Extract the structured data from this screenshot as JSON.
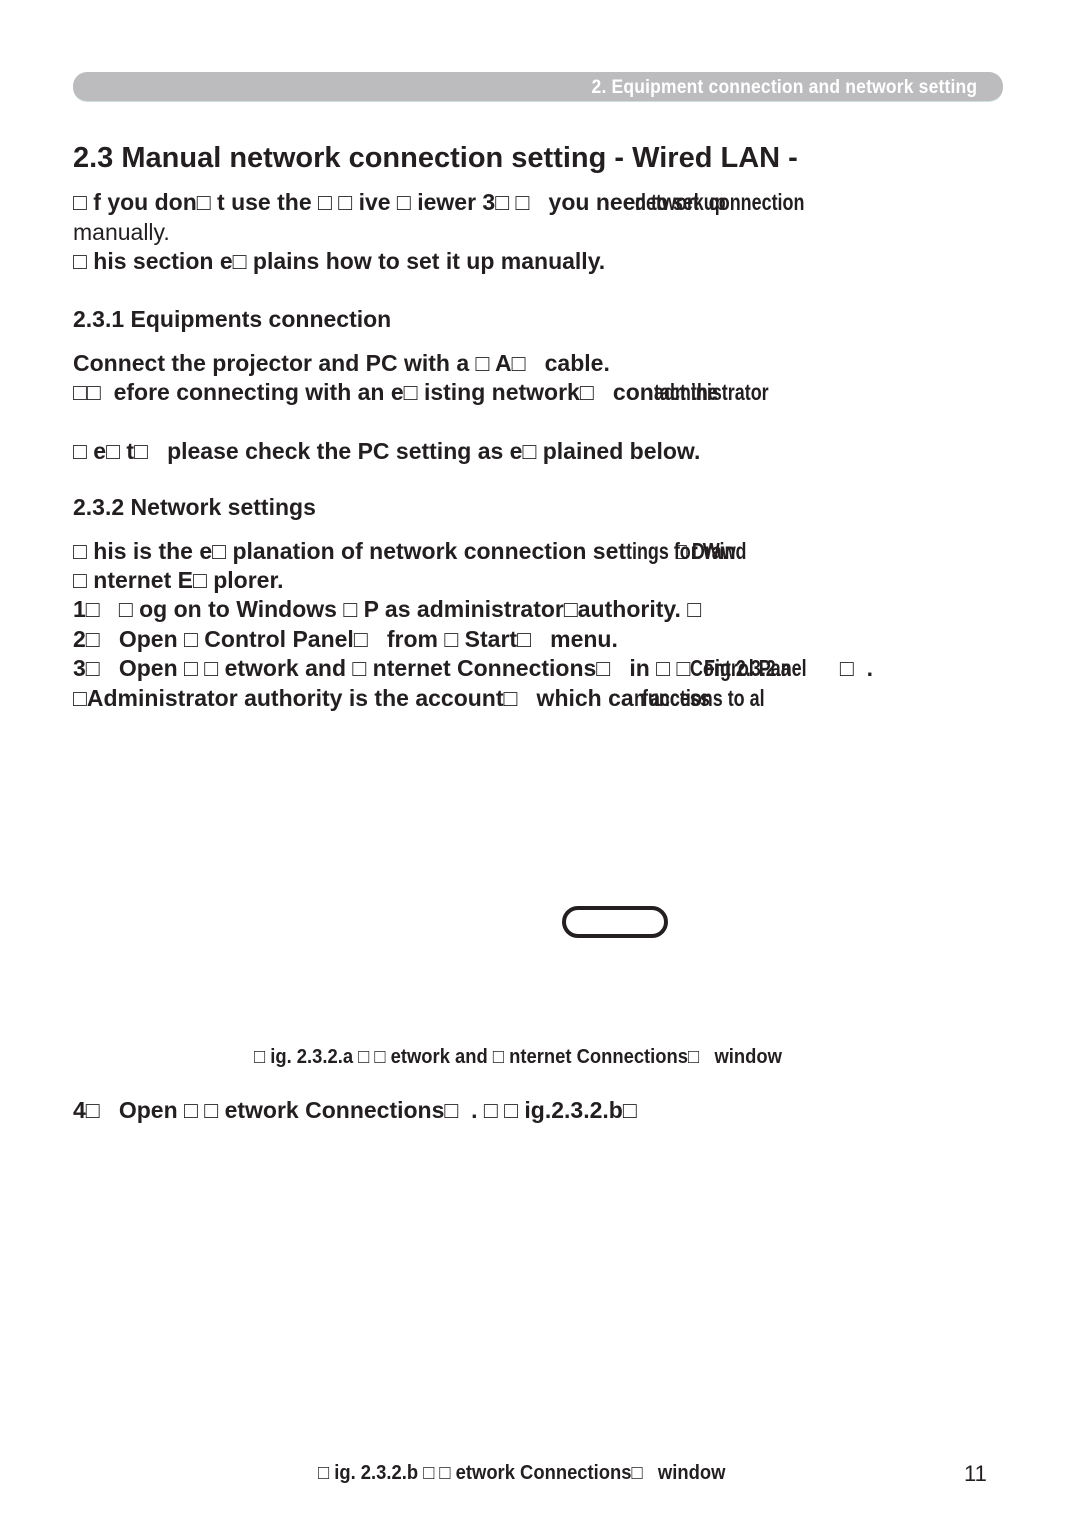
{
  "header": {
    "chapter": "2. Equipment connection and network setting"
  },
  "section": {
    "title": "2.3 Manual network connection setting - Wired LAN -",
    "intro": {
      "line1_a": "□ f you don□ t use the □ □ ive □ iewer 3□ □   you nee",
      "line1_over_a": "d to set up",
      "line1_over_b": "network connection",
      "line1_cont": "manually.",
      "line2": "□ his section e□ plains how to set it up manually."
    }
  },
  "subsection_1": {
    "title": "2.3.1 Equipments connection",
    "line1": "Connect the projector and PC with a □ A□   cable.",
    "line2_a": "□□  efore connecting with an e□ isting network□   con",
    "line2_over_a": "tact the",
    "line2_over_b": "administrator",
    "line3": "□ e□ t□   please check the PC setting as e□ plained below."
  },
  "subsection_2": {
    "title": "2.3.2 Network settings",
    "line1_a": "□ his is the e□ planation of network connection set",
    "line1_over_a": "tings for Wind",
    "line1_over_b": "□ Draw",
    "line2": "□ nternet E□ plorer.",
    "step1": "1□   □ og on to Windows □ P as administrator□authority. □",
    "step2": "2□   Open □ Control Panel□   from □ Start□   menu.",
    "step3_a": "3□   Open □ □ etwork and □ nternet Connections□   in □ □",
    "step3_over_a": "Control Panel",
    "step3_over_b": "Fig.2.3.2.a",
    "step3_end": "□  .",
    "note_a": "□Administrator authority is the account□   which ca",
    "note_over_a": "n access",
    "note_over_b": "functions to al",
    "fig_a_caption": "□ ig. 2.3.2.a □ □ etwork and □ nternet Connections□   window",
    "step4": "4□   Open □ □ etwork Connections□  . □ □ ig.2.3.2.b□",
    "fig_b_caption": "□ ig. 2.3.2.b □ □ etwork Connections□   window"
  },
  "page_number": "11"
}
